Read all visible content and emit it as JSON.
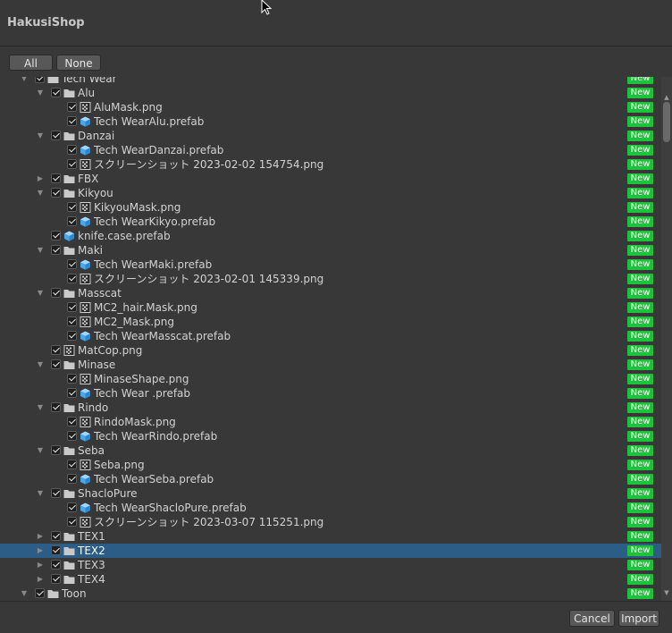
{
  "window": {
    "title": "HakusiShop"
  },
  "toolbar": {
    "all_label": "All",
    "none_label": "None"
  },
  "footer": {
    "cancel_label": "Cancel",
    "import_label": "Import"
  },
  "badge_text": "New",
  "colors": {
    "badge": "#1ec23a",
    "selection": "#2c5d87",
    "background": "#383838"
  },
  "tree": [
    {
      "depth": 0,
      "type": "folder",
      "label": "Tech Wear",
      "arrow": "down",
      "checked": true
    },
    {
      "depth": 1,
      "type": "folder",
      "label": "Alu",
      "arrow": "down",
      "checked": true
    },
    {
      "depth": 2,
      "type": "png",
      "label": "AluMask.png",
      "checked": true
    },
    {
      "depth": 2,
      "type": "prefab",
      "label": "Tech WearAlu.prefab",
      "checked": true
    },
    {
      "depth": 1,
      "type": "folder",
      "label": "Danzai",
      "arrow": "down",
      "checked": true
    },
    {
      "depth": 2,
      "type": "prefab",
      "label": "Tech WearDanzai.prefab",
      "checked": true
    },
    {
      "depth": 2,
      "type": "png",
      "label": "スクリーンショット 2023-02-02 154754.png",
      "checked": true
    },
    {
      "depth": 1,
      "type": "folder",
      "label": "FBX",
      "arrow": "right",
      "checked": true
    },
    {
      "depth": 1,
      "type": "folder",
      "label": "Kikyou",
      "arrow": "down",
      "checked": true
    },
    {
      "depth": 2,
      "type": "png",
      "label": "KikyouMask.png",
      "checked": true
    },
    {
      "depth": 2,
      "type": "prefab",
      "label": "Tech WearKikyo.prefab",
      "checked": true
    },
    {
      "depth": 1,
      "type": "prefab",
      "label": "knife.case.prefab",
      "checked": true
    },
    {
      "depth": 1,
      "type": "folder",
      "label": "Maki",
      "arrow": "down",
      "checked": true
    },
    {
      "depth": 2,
      "type": "prefab",
      "label": "Tech WearMaki.prefab",
      "checked": true
    },
    {
      "depth": 2,
      "type": "png",
      "label": "スクリーンショット 2023-02-01 145339.png",
      "checked": true
    },
    {
      "depth": 1,
      "type": "folder",
      "label": "Masscat",
      "arrow": "down",
      "checked": true
    },
    {
      "depth": 2,
      "type": "png",
      "label": "MC2_hair.Mask.png",
      "checked": true
    },
    {
      "depth": 2,
      "type": "png",
      "label": "MC2_Mask.png",
      "checked": true
    },
    {
      "depth": 2,
      "type": "prefab",
      "label": "Tech WearMasscat.prefab",
      "checked": true
    },
    {
      "depth": 1,
      "type": "png",
      "label": "MatCop.png",
      "checked": true
    },
    {
      "depth": 1,
      "type": "folder",
      "label": "Minase",
      "arrow": "down",
      "checked": true
    },
    {
      "depth": 2,
      "type": "png",
      "label": "MinaseShape.png",
      "checked": true
    },
    {
      "depth": 2,
      "type": "prefab",
      "label": "Tech Wear .prefab",
      "checked": true
    },
    {
      "depth": 1,
      "type": "folder",
      "label": "Rindo",
      "arrow": "down",
      "checked": true
    },
    {
      "depth": 2,
      "type": "png",
      "label": "RindoMask.png",
      "checked": true
    },
    {
      "depth": 2,
      "type": "prefab",
      "label": "Tech WearRindo.prefab",
      "checked": true
    },
    {
      "depth": 1,
      "type": "folder",
      "label": "Seba",
      "arrow": "down",
      "checked": true
    },
    {
      "depth": 2,
      "type": "png",
      "label": "Seba.png",
      "checked": true
    },
    {
      "depth": 2,
      "type": "prefab",
      "label": "Tech WearSeba.prefab",
      "checked": true
    },
    {
      "depth": 1,
      "type": "folder",
      "label": "ShacloPure",
      "arrow": "down",
      "checked": true
    },
    {
      "depth": 2,
      "type": "prefab",
      "label": "Tech WearShacloPure.prefab",
      "checked": true
    },
    {
      "depth": 2,
      "type": "png",
      "label": "スクリーンショット 2023-03-07 115251.png",
      "checked": true
    },
    {
      "depth": 1,
      "type": "folder",
      "label": "TEX1",
      "arrow": "right",
      "checked": true
    },
    {
      "depth": 1,
      "type": "folder",
      "label": "TEX2",
      "arrow": "right",
      "checked": true,
      "selected": true
    },
    {
      "depth": 1,
      "type": "folder",
      "label": "TEX3",
      "arrow": "right",
      "checked": true
    },
    {
      "depth": 1,
      "type": "folder",
      "label": "TEX4",
      "arrow": "right",
      "checked": true
    },
    {
      "depth": 0,
      "type": "folder",
      "label": "Toon",
      "arrow": "down",
      "checked": true
    }
  ]
}
